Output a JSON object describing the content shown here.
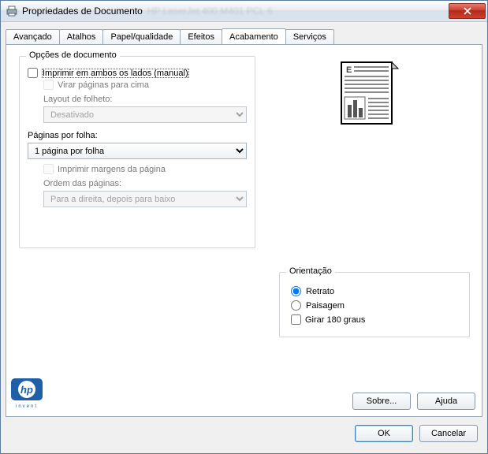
{
  "window": {
    "title": "Propriedades de Documento",
    "title_blur": "HP LaserJet 400 M401 PCL 6"
  },
  "tabs": {
    "t0": "Avançado",
    "t1": "Atalhos",
    "t2": "Papel/qualidade",
    "t3": "Efeitos",
    "t4": "Acabamento",
    "t5": "Serviços"
  },
  "doc_options": {
    "legend": "Opções de documento",
    "print_both": "Imprimir em ambos os lados (manual)",
    "flip_up": "Virar páginas para cima",
    "booklet_label": "Layout de folheto:",
    "booklet_value": "Desativado",
    "pages_per_label": "Páginas por folha:",
    "pages_per_value": "1 página por folha",
    "print_borders": "Imprimir margens da página",
    "page_order_label": "Ordem das páginas:",
    "page_order_value": "Para a direita, depois para baixo"
  },
  "orientation": {
    "legend": "Orientação",
    "portrait": "Retrato",
    "landscape": "Paisagem",
    "rotate": "Girar 180 graus"
  },
  "buttons": {
    "about": "Sobre...",
    "help": "Ajuda",
    "ok": "OK",
    "cancel": "Cancelar"
  },
  "logo": {
    "brand": "hp",
    "tag": "invent"
  }
}
